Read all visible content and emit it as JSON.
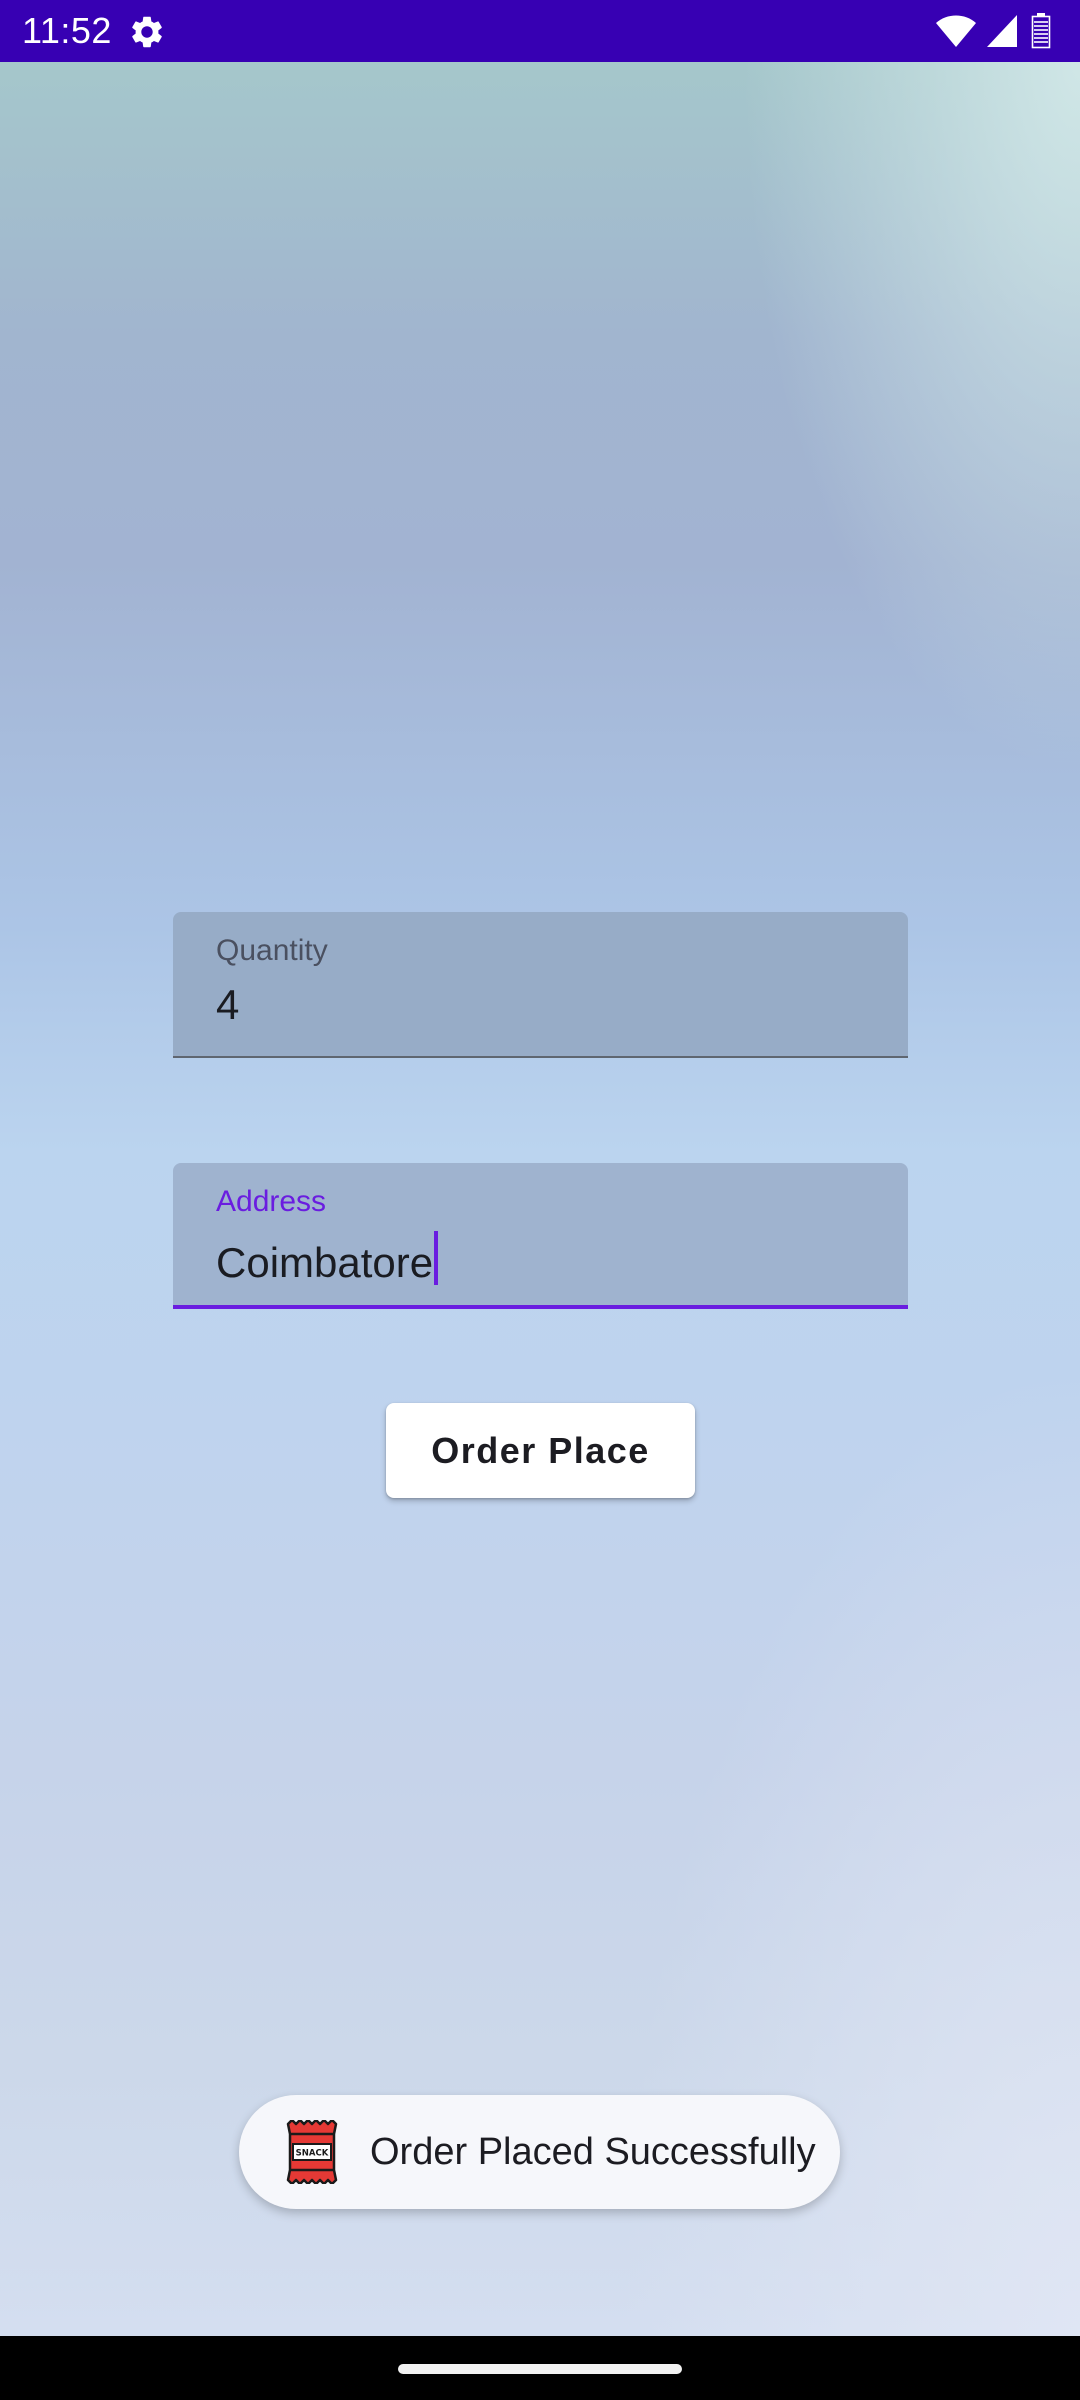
{
  "status_bar": {
    "time": "11:52",
    "icons": [
      "settings-icon",
      "wifi-icon",
      "cell-signal-icon",
      "battery-icon"
    ],
    "background": "#3700b3"
  },
  "form": {
    "quantity": {
      "label": "Quantity",
      "value": "4"
    },
    "address": {
      "label": "Address",
      "value": "Coimbatore",
      "focused": true
    }
  },
  "order_button": {
    "label": "Order Place"
  },
  "toast": {
    "icon": "snack-icon",
    "icon_text": "SNACK",
    "message": "Order Placed Successfully"
  },
  "colors": {
    "accent": "#6a1de0",
    "field_background": "#9fb3cf",
    "toast_background": "#f6f7fb"
  }
}
